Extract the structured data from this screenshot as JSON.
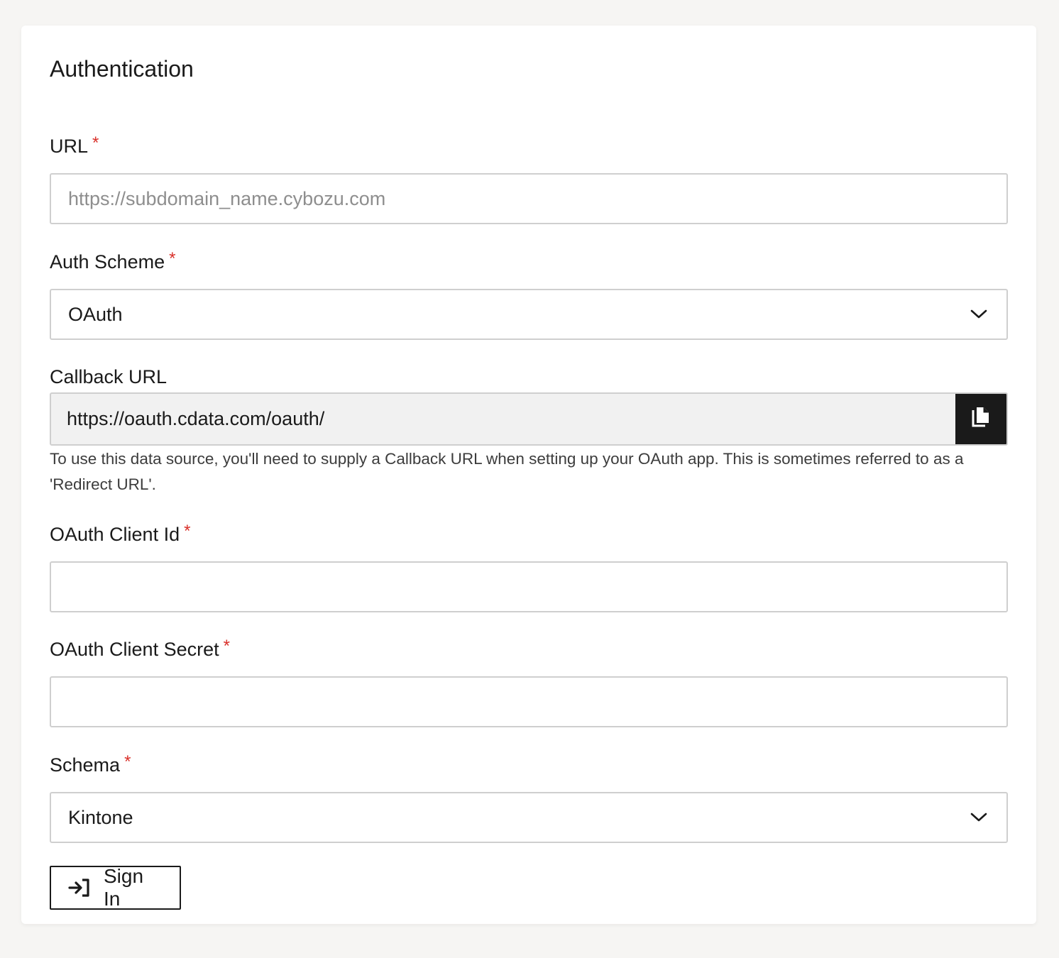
{
  "section": {
    "title": "Authentication"
  },
  "fields": {
    "url": {
      "label": "URL",
      "required_mark": "*",
      "placeholder": "https://subdomain_name.cybozu.com",
      "value": ""
    },
    "auth_scheme": {
      "label": "Auth Scheme",
      "required_mark": "*",
      "selected": "OAuth",
      "icon": "chevron-down-icon"
    },
    "callback_url": {
      "label": "Callback URL",
      "value": "https://oauth.cdata.com/oauth/",
      "copy_icon": "copy-icon",
      "help": "To use this data source, you'll need to supply a Callback URL when setting up your OAuth app. This is sometimes referred to as a 'Redirect URL'."
    },
    "client_id": {
      "label": "OAuth Client Id",
      "required_mark": "*",
      "value": ""
    },
    "client_secret": {
      "label": "OAuth Client Secret",
      "required_mark": "*",
      "value": ""
    },
    "schema": {
      "label": "Schema",
      "required_mark": "*",
      "selected": "Kintone",
      "icon": "chevron-down-icon"
    }
  },
  "actions": {
    "sign_in_label": "Sign In",
    "sign_in_icon": "sign-in-icon"
  },
  "colors": {
    "page_background": "#f6f5f3",
    "card_background": "#ffffff",
    "required_mark": "#d9302a",
    "input_border": "#cfcfcf",
    "readonly_background": "#f1f1f1",
    "copy_button_background": "#1a1a1a"
  }
}
